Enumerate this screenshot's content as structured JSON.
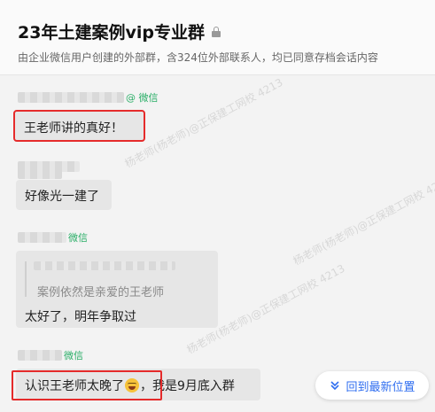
{
  "header": {
    "title": "23年土建案例vip专业群",
    "subtitle": "由企业微信用户创建的外部群，含324位外部联系人，均已同意存档会话内容"
  },
  "messages": [
    {
      "source": "@ 微信",
      "text": "王老师讲的真好！",
      "highlighted": true
    },
    {
      "text": "好像光一建了"
    },
    {
      "source": "微信",
      "quote": "案例依然是亲爱的王老师",
      "text": "太好了，明年争取过"
    },
    {
      "source": "微信",
      "text_before": "认识王老师太晚了",
      "emoji": "grinning-sweat-emoji",
      "text_after": "，我是9月底入群",
      "highlighted": true
    }
  ],
  "jump_button": {
    "label": "回到最新位置"
  },
  "watermark": "杨老师(杨老师)@正保建工网校 4213",
  "colors": {
    "highlight": "#e52b2b",
    "wechat_green": "#2aae67",
    "link_blue": "#2f6ef0"
  }
}
